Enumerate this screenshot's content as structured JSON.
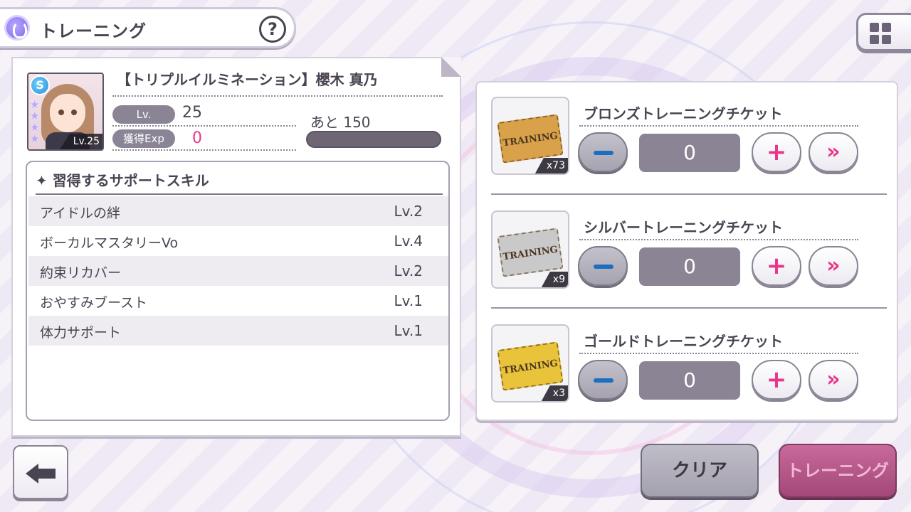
{
  "header": {
    "title": "トレーニング",
    "help_label": "?"
  },
  "menu": {
    "icon": "grid-icon"
  },
  "character": {
    "name": "【トリプルイルミネーション】櫻木 真乃",
    "rarity_label": "S",
    "card_level_tag": "Lv.25",
    "lv_label": "Lv.",
    "lv_value": "25",
    "exp_label": "獲得Exp",
    "exp_value": "0",
    "remaining_label": "あと 150",
    "exp_progress": 0
  },
  "skills": {
    "title": "✦ 習得するサポートスキル",
    "rows": [
      {
        "name": "アイドルの絆",
        "level": "Lv.2"
      },
      {
        "name": "ボーカルマスタリーVo",
        "level": "Lv.4"
      },
      {
        "name": "約束リカバー",
        "level": "Lv.2"
      },
      {
        "name": "おやすみブースト",
        "level": "Lv.1"
      },
      {
        "name": "体力サポート",
        "level": "Lv.1"
      }
    ]
  },
  "tickets": [
    {
      "name": "ブロンズトレーニングチケット",
      "label": "TRAINING",
      "count": "x73",
      "quantity": "0",
      "color": "#d9a24a"
    },
    {
      "name": "シルバートレーニングチケット",
      "label": "TRAINING",
      "count": "x9",
      "quantity": "0",
      "color": "#c9c9c9"
    },
    {
      "name": "ゴールドトレーニングチケット",
      "label": "TRAINING",
      "count": "x3",
      "quantity": "0",
      "color": "#e9c33a"
    }
  ],
  "buttons": {
    "plus": "+",
    "max": "»",
    "clear": "クリア",
    "train": "トレーニング"
  }
}
